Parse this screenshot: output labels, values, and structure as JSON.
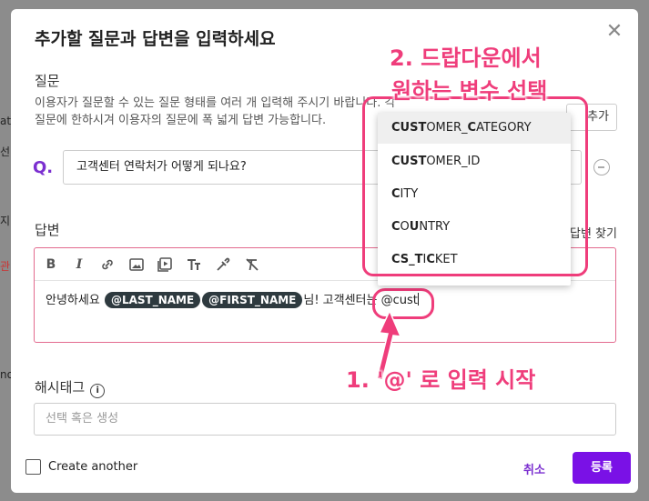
{
  "background": {
    "fragments": [
      "at",
      "선다",
      "지",
      "관",
      "지",
      "no",
      "지",
      "지"
    ]
  },
  "modal": {
    "title": "추가할 질문과 답변을 입력하세요",
    "close_icon": "close-icon"
  },
  "question": {
    "label": "질문",
    "description": "이용자가 질문할 수 있는 질문 형태를 여러 개 입력해 주시기 바랍니다. 각 질문에 한하시겨 이용자의 질문에 폭 넓게 답변 가능합니다.",
    "add_button": "추가",
    "q_marker": "Q.",
    "value": "고객센터 연락처가 어떻게 되나요?"
  },
  "answer": {
    "label": "답변",
    "find_answer": "답변 찾기",
    "toolbar": [
      "B",
      "I",
      "link",
      "image",
      "video",
      "text-size",
      "eyedropper",
      "clear-format"
    ],
    "text_prefix": "안녕하세요 ",
    "chips": [
      "@LAST_NAME",
      "@FIRST_NAME"
    ],
    "text_middle": "님! 고객센터는 ",
    "typed": "@cust"
  },
  "dropdown": {
    "items": [
      {
        "bold": "CUST",
        "mid": "OMER_",
        "bold2": "C",
        "rest": "ATEGORY",
        "full": "CUSTOMER_CATEGORY"
      },
      {
        "bold": "CUST",
        "mid": "OMER_ID",
        "bold2": "",
        "rest": "",
        "full": "CUSTOMER_ID"
      },
      {
        "bold": "C",
        "mid": "ITY",
        "bold2": "",
        "rest": "",
        "full": "CITY"
      },
      {
        "bold": "C",
        "mid": "O",
        "bold2": "U",
        "rest": "NTRY",
        "full": "COUNTRY"
      },
      {
        "bold": "CS_T",
        "mid": "I",
        "bold2": "C",
        "rest": "KET",
        "full": "CS_TICKET"
      }
    ],
    "active_index": 0
  },
  "hashtag": {
    "label": "해시태그",
    "placeholder": "선택 혹은 생성"
  },
  "footer": {
    "create_another": "Create another",
    "cancel": "취소",
    "submit": "등록"
  },
  "annotations": {
    "step1": "1. '@' 로 입력 시작",
    "step2_line1": "2. 드랍다운에서",
    "step2_line2": "원하는 변수 선택"
  },
  "colors": {
    "accent": "#7a11e6",
    "annotation": "#ef3d7b"
  }
}
